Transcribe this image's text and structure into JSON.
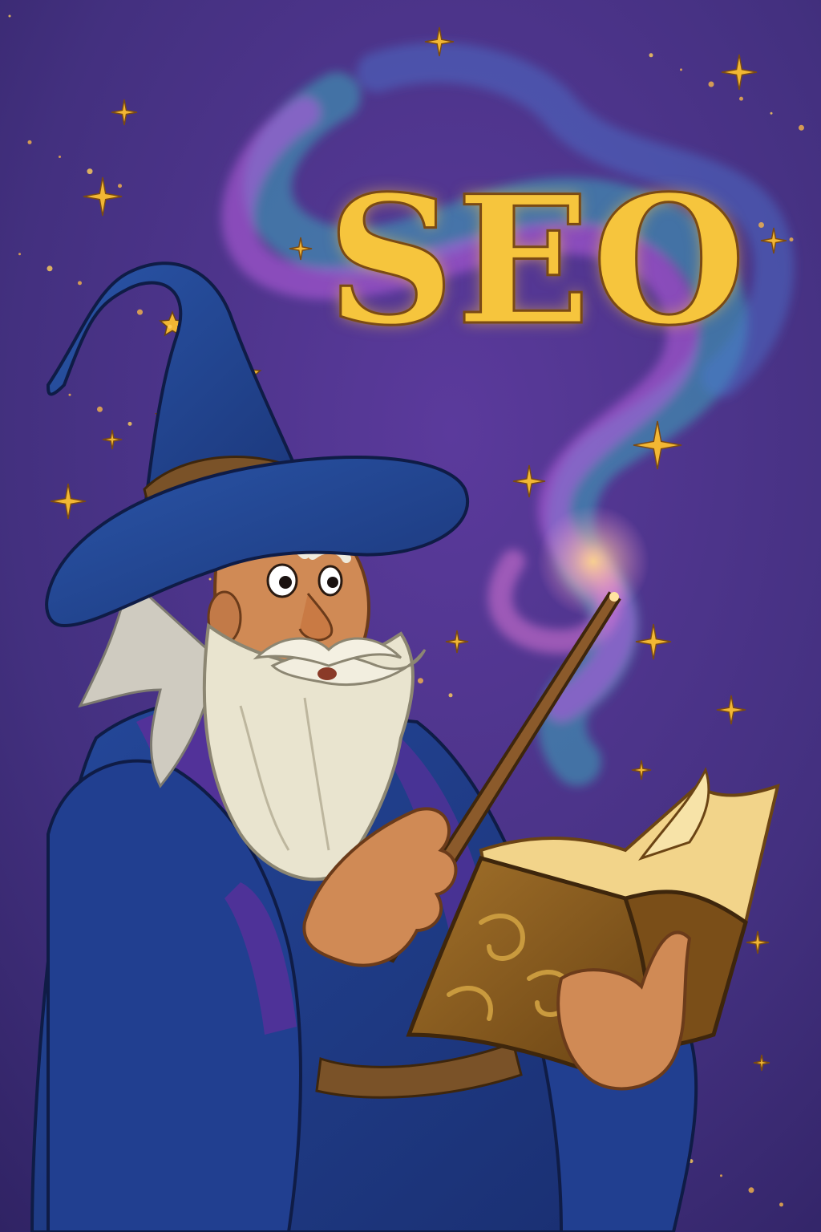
{
  "illustration": {
    "title_text": "SEO",
    "subject": "wizard",
    "elements": [
      "wizard-hat",
      "wizard-face",
      "wizard-beard",
      "wizard-robe",
      "magic-wand",
      "spell-book",
      "magic-smoke",
      "stars"
    ]
  },
  "palette": {
    "background": "#3f2b7a",
    "gold": "#f2b733",
    "robe_blue": "#1f3f8f",
    "robe_purple": "#5a2f9a",
    "skin": "#d08a55",
    "beard": "#e9e4cf",
    "smoke_teal": "#3aa6b9",
    "smoke_violet": "#b05cd8",
    "book_brown": "#8a5a1c"
  }
}
